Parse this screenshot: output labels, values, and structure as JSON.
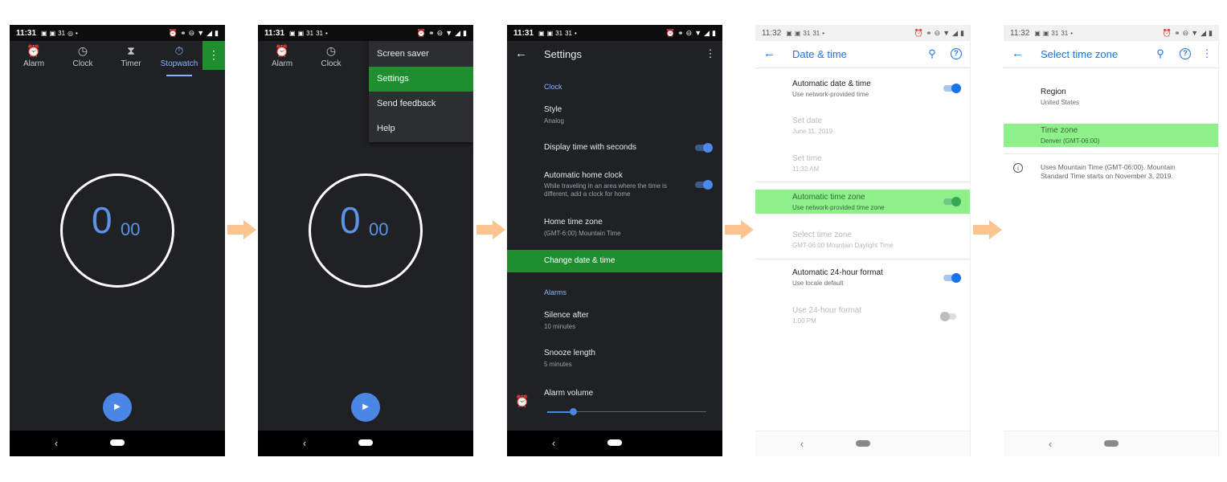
{
  "status": {
    "time_dark": "11:31",
    "time_light": "11:32",
    "left_icons": [
      "▣",
      "▣",
      "31",
      "31"
    ],
    "right_icons": [
      "⏰",
      "⚭",
      "⊖",
      "▼",
      "◢",
      "▮"
    ]
  },
  "nav": {
    "back_icon": "‹"
  },
  "clock_tabs": [
    {
      "label": "Alarm",
      "icon": "⏰"
    },
    {
      "label": "Clock",
      "icon": "◷"
    },
    {
      "label": "Timer",
      "icon": "⧗"
    },
    {
      "label": "Stopwatch",
      "icon": "⏱"
    }
  ],
  "active_tab": "Stopwatch",
  "overflow_icon": "⋮",
  "stopwatch": {
    "big": "0",
    "small": "00",
    "play_icon": "▶"
  },
  "overflow_menu": [
    "Screen saver",
    "Settings",
    "Send feedback",
    "Help"
  ],
  "overflow_menu_selected": "Settings",
  "settings": {
    "title": "Settings",
    "back_icon": "←",
    "more_icon": "⋮",
    "sections": {
      "clock": "Clock",
      "alarms": "Alarms"
    },
    "items": {
      "style": {
        "title": "Style",
        "sub": "Analog"
      },
      "seconds": {
        "title": "Display time with seconds",
        "on": true
      },
      "home_clock": {
        "title": "Automatic home clock",
        "sub": "While traveling in an area where the time is different, add a clock for home",
        "on": true
      },
      "home_tz": {
        "title": "Home time zone",
        "sub": "(GMT-6:00) Mountain Time"
      },
      "change_dt": {
        "title": "Change date & time"
      },
      "silence": {
        "title": "Silence after",
        "sub": "10 minutes"
      },
      "snooze": {
        "title": "Snooze length",
        "sub": "5 minutes"
      },
      "alarm_volume": {
        "title": "Alarm volume",
        "level": 0.16
      }
    }
  },
  "date_time": {
    "title": "Date & time",
    "back_icon": "←",
    "search_icon": "⚲",
    "help_icon": "?",
    "items": {
      "auto_dt": {
        "title": "Automatic date & time",
        "sub": "Use network-provided time",
        "on": true
      },
      "set_date": {
        "title": "Set date",
        "sub": "June 11, 2019"
      },
      "set_time": {
        "title": "Set time",
        "sub": "11:32 AM"
      },
      "auto_tz": {
        "title": "Automatic time zone",
        "sub": "Use network-provided time zone",
        "on": true
      },
      "select_tz": {
        "title": "Select time zone",
        "sub": "GMT-06:00 Mountain Daylight Time"
      },
      "auto_24": {
        "title": "Automatic 24-hour format",
        "sub": "Use locale default",
        "on": true
      },
      "use_24": {
        "title": "Use 24-hour format",
        "sub": "1:00 PM",
        "on": false
      }
    }
  },
  "time_zone": {
    "title": "Select time zone",
    "back_icon": "←",
    "search_icon": "⚲",
    "help_icon": "?",
    "more_icon": "⋮",
    "region": {
      "title": "Region",
      "sub": "United States"
    },
    "zone": {
      "title": "Time zone",
      "sub": "Denver (GMT-06:00)"
    },
    "info_icon": "i",
    "info": "Uses Mountain Time (GMT-06:00). Mountain Standard Time starts on November 3, 2019."
  }
}
